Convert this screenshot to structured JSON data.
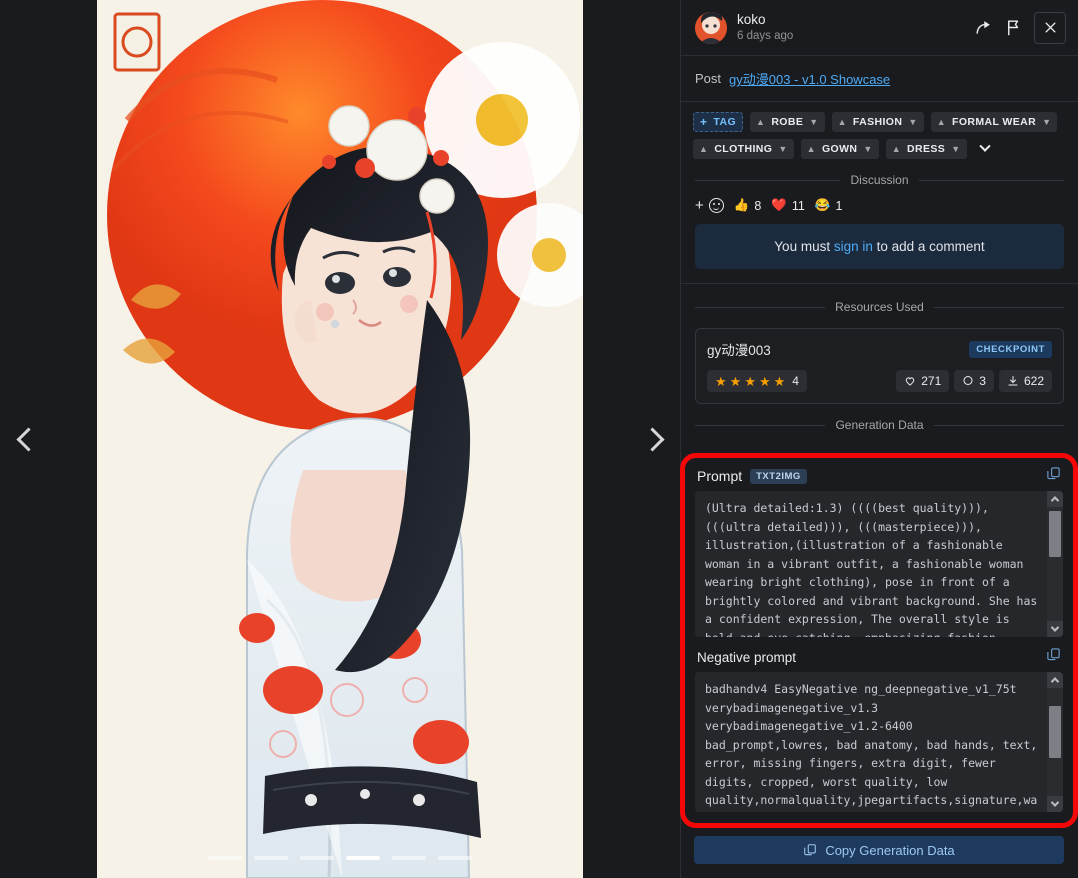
{
  "viewer": {
    "prev_label": "Previous image",
    "next_label": "Next image",
    "dot_count": 6,
    "active_dot": 5
  },
  "header": {
    "username": "koko",
    "timestamp": "6 days ago",
    "share_icon": "share-icon",
    "flag_icon": "flag-icon",
    "close_icon": "close-icon"
  },
  "post": {
    "label": "Post",
    "link": "gy动漫003 - v1.0 Showcase"
  },
  "tags": {
    "add_label": "TAG",
    "items": [
      {
        "label": "ROBE"
      },
      {
        "label": "FASHION"
      },
      {
        "label": "FORMAL WEAR"
      },
      {
        "label": "CLOTHING"
      },
      {
        "label": "GOWN"
      },
      {
        "label": "DRESS"
      }
    ],
    "more_icon": "chevron-down-icon"
  },
  "discussion": {
    "divider_label": "Discussion",
    "add_reaction_icon": "add-reaction-icon",
    "reactions": [
      {
        "emoji": "👍",
        "count": "8"
      },
      {
        "emoji": "❤️",
        "count": "11"
      },
      {
        "emoji": "😂",
        "count": "1"
      }
    ],
    "signin_prefix": "You must ",
    "signin_link": "sign in",
    "signin_suffix": " to add a comment"
  },
  "resources": {
    "divider_label": "Resources Used",
    "card": {
      "name": "gy动漫003",
      "badge": "CHECKPOINT",
      "rating_stars": 5,
      "rating_count": "4",
      "likes": "271",
      "comments": "3",
      "downloads": "622"
    }
  },
  "generation": {
    "divider_label": "Generation Data",
    "prompt_label": "Prompt",
    "prompt_badge": "TXT2IMG",
    "prompt_text": "(Ultra detailed:1.3) ((((best quality))), (((ultra detailed))), (((masterpiece))), illustration,(illustration of a fashionable woman in a vibrant outfit, a fashionable woman wearing bright clothing), pose in front of a brightly colored and vibrant background. She has a confident expression, The overall style is bold and eye catching, emphasizing fashion",
    "negative_label": "Negative prompt",
    "negative_text": "badhandv4 EasyNegative ng_deepnegative_v1_75t verybadimagenegative_v1.3 verybadimagenegative_v1.2-6400 bad_prompt,lowres, bad anatomy, bad hands, text, error, missing fingers, extra digit, fewer digits, cropped, worst quality, low quality,normalquality,jpegartifacts,signature,watermark,username,blurry,watermark,signature,wa",
    "copy_icon": "copy-icon",
    "copy_button_label": "Copy Generation Data",
    "highlight_color": "#f50707"
  }
}
